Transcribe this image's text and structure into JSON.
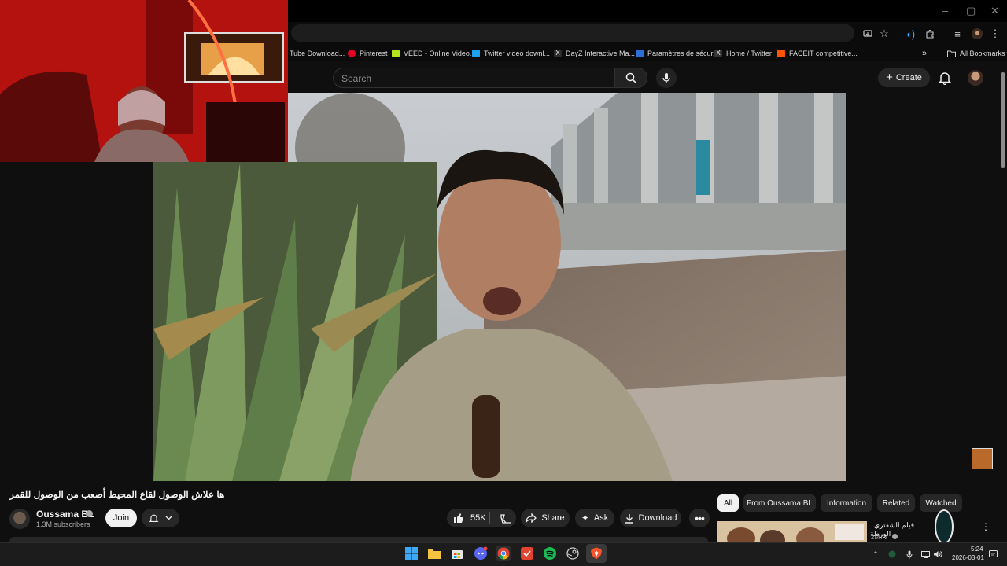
{
  "browser": {
    "window_controls": [
      "–",
      "▢",
      "✕"
    ],
    "bookmarks": [
      {
        "label": "Tube Download...",
        "icon": "download-icon",
        "color": "#e33"
      },
      {
        "label": "Pinterest",
        "icon": "pinterest-icon",
        "color": "#e60023"
      },
      {
        "label": "VEED - Online Video...",
        "icon": "veed-icon",
        "color": "#b5e61d"
      },
      {
        "label": "Twitter video downl...",
        "icon": "twitter-dl-icon",
        "color": "#1da1f2"
      },
      {
        "label": "DayZ Interactive Ma...",
        "icon": "dayz-icon",
        "color": "#2c2c2c"
      },
      {
        "label": "Paramètres de sécur...",
        "icon": "security-icon",
        "color": "#2b6fd6"
      },
      {
        "label": "Home / Twitter",
        "icon": "x-icon",
        "color": "#333"
      },
      {
        "label": "FACEIT competitive...",
        "icon": "faceit-icon",
        "color": "#ff5500"
      }
    ],
    "bookmarks_overflow": "»",
    "all_bookmarks_label": "All Bookmarks"
  },
  "youtube": {
    "search_placeholder": "Search",
    "create_label": "Create",
    "video_title": "ها علاش الوصول لقاع المحيط أصعب من الوصول للقمر",
    "channel": {
      "name": "Oussama BL",
      "subscribers": "1.3M subscribers",
      "verified": true
    },
    "join_label": "Join",
    "actions": {
      "likes": "55K",
      "share_label": "Share",
      "ask_label": "Ask",
      "download_label": "Download"
    },
    "chips": [
      "All",
      "From Oussama BL",
      "Information",
      "Related",
      "Watched"
    ],
    "selected_chip": "All",
    "recommendation": {
      "title": "فيلم الشفتري : الورطة",
      "channel": "2MTV",
      "verified": true
    }
  },
  "taskbar": {
    "apps": [
      "windows-start",
      "file-explorer",
      "microsoft-store",
      "discord",
      "chrome",
      "todoist",
      "spotify",
      "steam",
      "brave"
    ],
    "time": "5:24",
    "date": "2026-03-01"
  },
  "colors": {
    "background": "#0f0f0f",
    "accent": "#3ea6ff",
    "chip_selected_bg": "#f1f1f1"
  }
}
